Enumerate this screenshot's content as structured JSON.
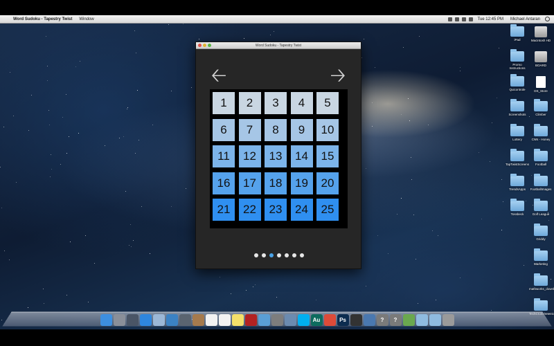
{
  "menubar": {
    "app_name": "Word Sudoku - Tapestry Twist",
    "menus": [
      "Window"
    ],
    "clock": "Tue 12:45 PM",
    "user": "Michael Antaran"
  },
  "window": {
    "title": "Word Sudoku - Tapestry Twist",
    "grid": [
      {
        "label": "1",
        "color": "#c9d6e2"
      },
      {
        "label": "2",
        "color": "#c9d6e2"
      },
      {
        "label": "3",
        "color": "#c9d6e2"
      },
      {
        "label": "4",
        "color": "#c9d6e2"
      },
      {
        "label": "5",
        "color": "#c9d6e2"
      },
      {
        "label": "6",
        "color": "#a6c6e6"
      },
      {
        "label": "7",
        "color": "#a6c6e6"
      },
      {
        "label": "8",
        "color": "#a6c6e6"
      },
      {
        "label": "9",
        "color": "#a6c6e6"
      },
      {
        "label": "10",
        "color": "#a6c6e6"
      },
      {
        "label": "11",
        "color": "#7cb4ea"
      },
      {
        "label": "12",
        "color": "#7cb4ea"
      },
      {
        "label": "13",
        "color": "#7cb4ea"
      },
      {
        "label": "14",
        "color": "#7cb4ea"
      },
      {
        "label": "15",
        "color": "#7cb4ea"
      },
      {
        "label": "16",
        "color": "#55a2ec"
      },
      {
        "label": "17",
        "color": "#55a2ec"
      },
      {
        "label": "18",
        "color": "#55a2ec"
      },
      {
        "label": "19",
        "color": "#55a2ec"
      },
      {
        "label": "20",
        "color": "#55a2ec"
      },
      {
        "label": "21",
        "color": "#2f8ff0"
      },
      {
        "label": "22",
        "color": "#2f8ff0"
      },
      {
        "label": "23",
        "color": "#2f8ff0"
      },
      {
        "label": "24",
        "color": "#2f8ff0"
      },
      {
        "label": "25",
        "color": "#2f8ff0"
      }
    ],
    "page_dots": 7,
    "active_page": 3
  },
  "desktop_icons": [
    {
      "label": "iPad",
      "kind": "folder"
    },
    {
      "label": "Macintosh HD",
      "kind": "drive"
    },
    {
      "label": "Promo Instructions",
      "kind": "folder"
    },
    {
      "label": "BOARD",
      "kind": "drive"
    },
    {
      "label": "Quicontrole",
      "kind": "folder"
    },
    {
      "label": "DS_Store",
      "kind": "doc"
    },
    {
      "label": "Screenshots",
      "kind": "folder"
    },
    {
      "label": "Climber",
      "kind": "folder"
    },
    {
      "label": "Lottery",
      "kind": "folder"
    },
    {
      "label": "CNN - Honey",
      "kind": "folder"
    },
    {
      "label": "TapTwistScreens",
      "kind": "folder"
    },
    {
      "label": "Football",
      "kind": "folder"
    },
    {
      "label": "TrendsApps",
      "kind": "folder"
    },
    {
      "label": "FootballImages",
      "kind": "folder"
    },
    {
      "label": "Tossbeck",
      "kind": "folder"
    },
    {
      "label": "Golf League",
      "kind": "folder"
    },
    {
      "label": "Griddy",
      "kind": "folder"
    },
    {
      "label": "Marketing",
      "kind": "folder"
    },
    {
      "label": "mathworks_downloads",
      "kind": "folder"
    },
    {
      "label": "TechCrunchMetrics",
      "kind": "folder"
    }
  ],
  "dock": [
    {
      "name": "finder",
      "color": "#3d8fe0",
      "glyph": ""
    },
    {
      "name": "launchpad",
      "color": "#8a8f99",
      "glyph": ""
    },
    {
      "name": "mission-control",
      "color": "#4a5566",
      "glyph": ""
    },
    {
      "name": "app-store",
      "color": "#2e86de",
      "glyph": ""
    },
    {
      "name": "mail",
      "color": "#9bb7d6",
      "glyph": ""
    },
    {
      "name": "safari",
      "color": "#3b82c4",
      "glyph": ""
    },
    {
      "name": "facetime",
      "color": "#5a6470",
      "glyph": ""
    },
    {
      "name": "contacts",
      "color": "#a57a4d",
      "glyph": ""
    },
    {
      "name": "calendar",
      "color": "#f2f2f2",
      "glyph": ""
    },
    {
      "name": "reminders",
      "color": "#f2f2f2",
      "glyph": ""
    },
    {
      "name": "notes",
      "color": "#f4e06a",
      "glyph": ""
    },
    {
      "name": "photo-booth",
      "color": "#b22222",
      "glyph": ""
    },
    {
      "name": "itunes",
      "color": "#5a9fd6",
      "glyph": ""
    },
    {
      "name": "iphoto",
      "color": "#7d7d7d",
      "glyph": ""
    },
    {
      "name": "preview",
      "color": "#6b8bb0",
      "glyph": ""
    },
    {
      "name": "skype",
      "color": "#00aff0",
      "glyph": ""
    },
    {
      "name": "audition",
      "color": "#0d6b5e",
      "glyph": "Au"
    },
    {
      "name": "chrome",
      "color": "#dd4b39",
      "glyph": ""
    },
    {
      "name": "photoshop",
      "color": "#0c2c4f",
      "glyph": "Ps"
    },
    {
      "name": "unity",
      "color": "#333333",
      "glyph": ""
    },
    {
      "name": "xcode",
      "color": "#4a78b0",
      "glyph": ""
    },
    {
      "name": "help",
      "color": "#7a7a7a",
      "glyph": "?"
    },
    {
      "name": "help-2",
      "color": "#7a7a7a",
      "glyph": "?"
    },
    {
      "name": "stack",
      "color": "#6aa84f",
      "glyph": ""
    },
    {
      "name": "downloads",
      "color": "#8fbbe0",
      "glyph": ""
    },
    {
      "name": "documents",
      "color": "#8fbbe0",
      "glyph": ""
    },
    {
      "name": "trash",
      "color": "#9a9a9a",
      "glyph": ""
    }
  ]
}
